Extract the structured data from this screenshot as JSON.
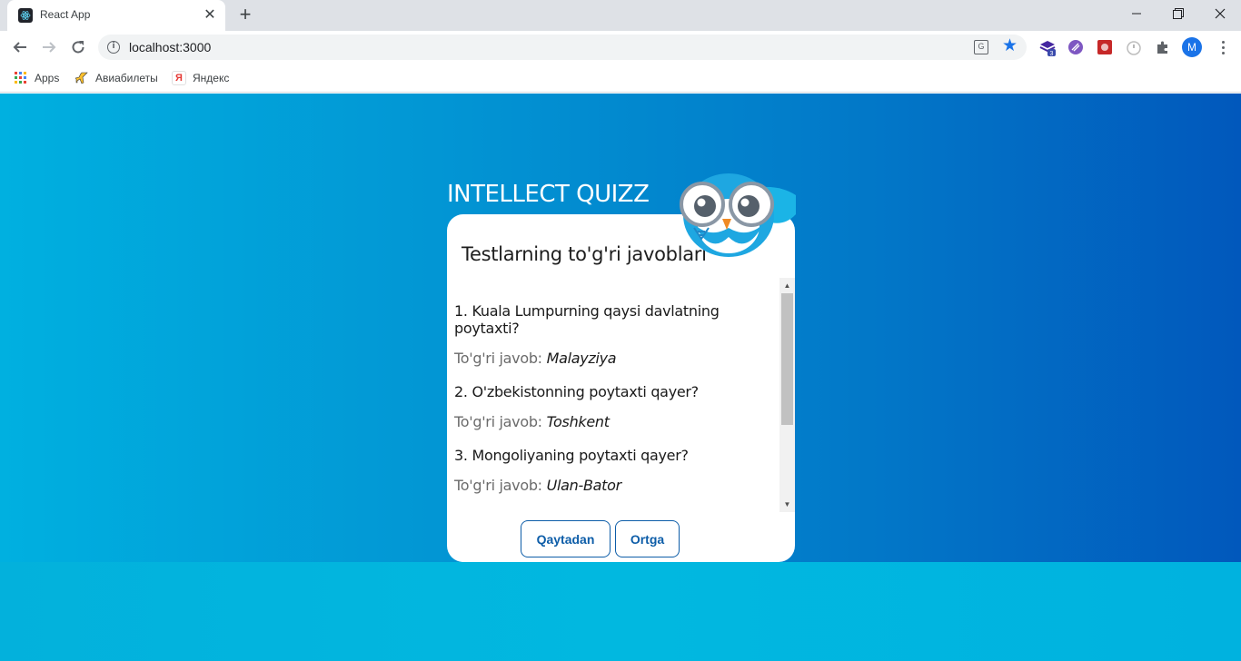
{
  "browser": {
    "tab_title": "React App",
    "tab_close": "✕",
    "new_tab": "+",
    "url": "localhost:3000",
    "info_glyph": "i",
    "star_glyph": "★",
    "profile_initial": "M",
    "extension_badge": "3",
    "translate_glyph": "G",
    "bookmarks": [
      {
        "label": "Apps",
        "icon": "apps-grid-icon"
      },
      {
        "label": "Авиабилеты",
        "icon": "airplane-icon"
      },
      {
        "label": "Яндекс",
        "icon": "yandex-icon"
      }
    ],
    "yandex_glyph": "Я",
    "colors": {
      "accent": "#1a73e8",
      "tabstrip": "#dee1e6"
    }
  },
  "app": {
    "title": "INTELLECT QUIZZ",
    "card_title": "Testlarning to'g'ri javoblari",
    "answer_prefix": "To'g'ri javob: ",
    "questions": [
      {
        "question": "1. Kuala Lumpurning qaysi davlatning poytaxti?",
        "answer": "Malayziya"
      },
      {
        "question": "2. O'zbekistonning poytaxti qayer?",
        "answer": "Toshkent"
      },
      {
        "question": "3. Mongoliyaning poytaxti qayer?",
        "answer": "Ulan-Bator"
      }
    ],
    "buttons": {
      "restart": "Qaytadan",
      "back": "Ortga"
    },
    "colors": {
      "button": "#0d5da8",
      "bg_start": "#00b0e0",
      "bg_end": "#0158bc"
    }
  }
}
